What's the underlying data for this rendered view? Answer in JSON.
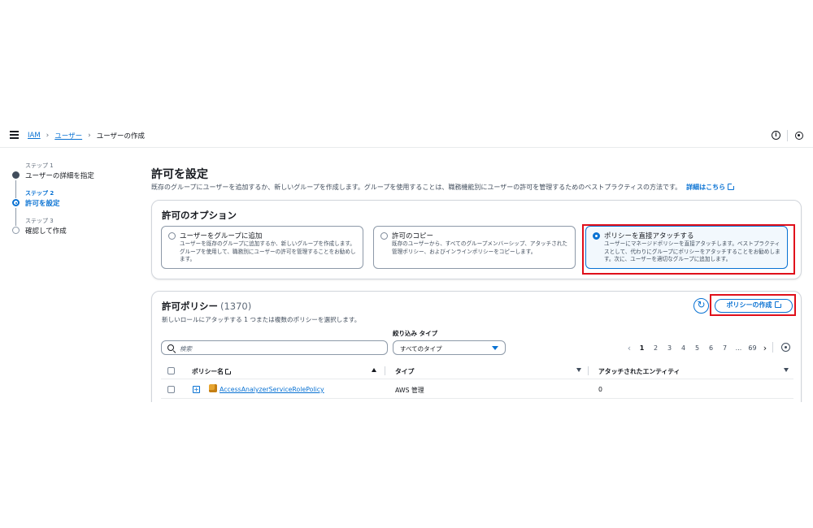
{
  "breadcrumb": {
    "root": "IAM",
    "users": "ユーザー",
    "current": "ユーザーの作成"
  },
  "topbar": {
    "info_icon": "info-icon",
    "settings_icon": "gear-icon",
    "info_glyph": "i"
  },
  "steps": [
    {
      "small": "ステップ 1",
      "label": "ユーザーの詳細を指定",
      "state": "done"
    },
    {
      "small": "ステップ 2",
      "label": "許可を設定",
      "state": "active"
    },
    {
      "small": "ステップ 3",
      "label": "確認して作成",
      "state": "todo"
    }
  ],
  "page": {
    "title": "許可を設定",
    "description": "既存のグループにユーザーを追加するか、新しいグループを作成します。グループを使用することは、職務機能別にユーザーの許可を管理するためのベストプラクティスの方法です。",
    "learn_more": "詳細はこちら"
  },
  "options": {
    "title": "許可のオプション",
    "tiles": [
      {
        "title": "ユーザーをグループに追加",
        "description": "ユーザーを既存のグループに追加するか、新しいグループを作成します。グループを使用して、職務別にユーザーの許可を管理することをお勧めします。",
        "selected": false
      },
      {
        "title": "許可のコピー",
        "description": "既存のユーザーから、すべてのグループメンバーシップ、アタッチされた管理ポリシー、およびインラインポリシーをコピーします。",
        "selected": false
      },
      {
        "title": "ポリシーを直接アタッチする",
        "description": "ユーザーにマネージドポリシーを直接アタッチします。ベストプラクティスとして、代わりにグループにポリシーをアタッチすることをお勧めします。次に、ユーザーを適切なグループに追加します。",
        "selected": true
      }
    ]
  },
  "policies": {
    "title": "許可ポリシー",
    "count": "(1370)",
    "description": "新しいロールにアタッチする 1 つまたは複数のポリシーを選択します。",
    "create_button": "ポリシーの作成",
    "refresh_glyph": "↻",
    "filter_label": "絞り込み タイプ",
    "search_placeholder": "検索",
    "type_select": "すべてのタイプ",
    "pagination": {
      "prev": "‹",
      "next": "›",
      "pages": [
        "1",
        "2",
        "3",
        "4",
        "5",
        "6",
        "7",
        "...",
        "69"
      ],
      "current": "1"
    },
    "columns": {
      "name": "ポリシー名",
      "type": "タイプ",
      "entities": "アタッチされたエンティティ"
    },
    "rows": [
      {
        "name": "AccessAnalyzerServiceRolePolicy",
        "type": "AWS 管理",
        "entities": "0"
      }
    ],
    "expand_glyph": "+"
  },
  "colors": {
    "accent": "#0972d3",
    "highlight": "#e0101b",
    "text": "#16191f"
  }
}
